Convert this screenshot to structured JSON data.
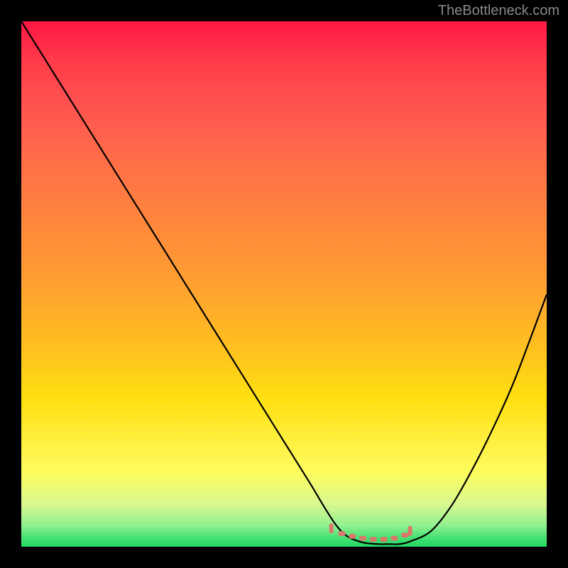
{
  "attribution": "TheBottleneck.com",
  "chart_data": {
    "type": "line",
    "title": "",
    "xlabel": "",
    "ylabel": "",
    "xlim": [
      0,
      100
    ],
    "ylim": [
      0,
      100
    ],
    "series": [
      {
        "name": "bottleneck-curve",
        "x": [
          0,
          5,
          10,
          15,
          20,
          25,
          30,
          35,
          40,
          45,
          50,
          55,
          58,
          60,
          62,
          65,
          68,
          70,
          72,
          74,
          78,
          82,
          86,
          90,
          94,
          100
        ],
        "y": [
          100,
          92,
          84,
          76,
          68,
          60,
          52,
          44,
          36,
          28,
          20,
          12,
          7,
          4,
          2,
          0.8,
          0.5,
          0.5,
          0.5,
          1,
          3,
          8,
          15,
          23,
          32,
          48
        ]
      }
    ],
    "markers": {
      "name": "optimal-zone",
      "x": [
        59,
        61,
        63,
        65,
        67,
        69,
        71,
        73,
        74
      ],
      "y": [
        3.5,
        2.5,
        2,
        1.6,
        1.4,
        1.4,
        1.6,
        2.2,
        3
      ]
    },
    "gradient_stops": [
      {
        "pos": 0,
        "color": "#ff1744"
      },
      {
        "pos": 50,
        "color": "#ffa030"
      },
      {
        "pos": 85,
        "color": "#fdfd60"
      },
      {
        "pos": 100,
        "color": "#26d968"
      }
    ]
  }
}
